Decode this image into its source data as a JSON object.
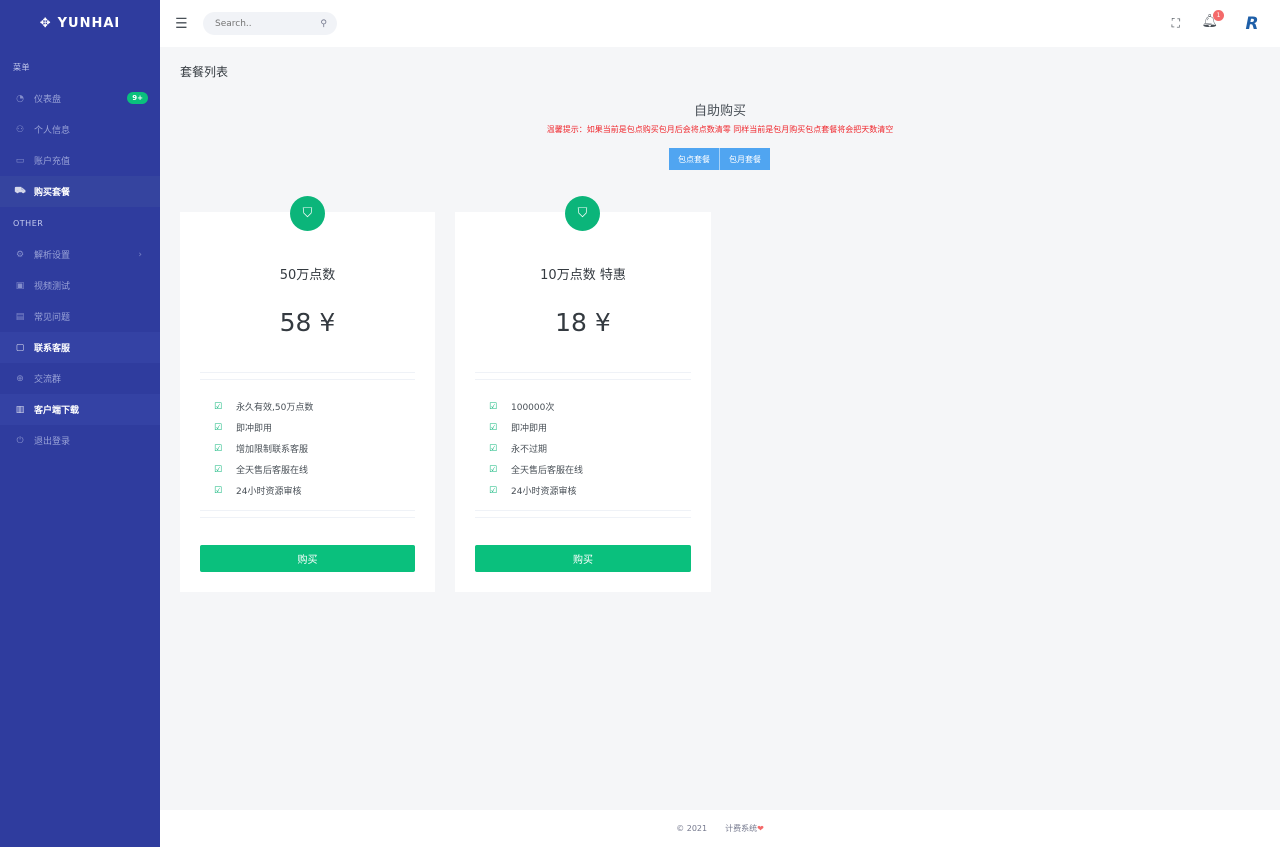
{
  "brand": {
    "name": "YUNHAI",
    "icon": "move-icon"
  },
  "sidebar": {
    "section_menu": "菜单",
    "section_other": "OTHER",
    "items": [
      {
        "label": "仪表盘",
        "icon": "dashboard-icon",
        "badge": "9+"
      },
      {
        "label": "个人信息",
        "icon": "user-icon"
      },
      {
        "label": "账户充值",
        "icon": "card-icon"
      },
      {
        "label": "购买套餐",
        "icon": "cart-icon"
      },
      {
        "label": "解析设置",
        "icon": "settings-icon"
      },
      {
        "label": "视频测试",
        "icon": "video-icon"
      },
      {
        "label": "常见问题",
        "icon": "book-icon"
      },
      {
        "label": "联系客服",
        "icon": "chat-icon"
      },
      {
        "label": "交流群",
        "icon": "group-icon"
      },
      {
        "label": "客户端下载",
        "icon": "file-icon"
      },
      {
        "label": "退出登录",
        "icon": "power-icon"
      }
    ]
  },
  "topbar": {
    "search_placeholder": "Search..",
    "notification_count": "1",
    "avatar_letter": "R"
  },
  "page": {
    "title": "套餐列表",
    "self_title": "自助购买",
    "notice": "温馨提示：如果当前是包点购买包月后会将点数清零 同样当前是包月购买包点套餐将会把天数清空",
    "tabs": [
      "包点套餐",
      "包月套餐"
    ]
  },
  "plans": [
    {
      "name": "50万点数",
      "price": "58 ¥",
      "features": [
        "永久有效,50万点数",
        "即冲即用",
        "增加限制联系客服",
        "全天售后客服在线",
        "24小时资源审核"
      ],
      "button": "购买"
    },
    {
      "name": "10万点数 特惠",
      "price": "18 ¥",
      "features": [
        "100000次",
        "即冲即用",
        "永不过期",
        "全天售后客服在线",
        "24小时资源审核"
      ],
      "button": "购买"
    }
  ],
  "footer": {
    "copyright": "© 2021",
    "system": "计费系统",
    "heart": "❤"
  },
  "colors": {
    "sidebar": "#2f3c9e",
    "accent_green": "#0ac07d",
    "tab_blue": "#50a5f1",
    "notice_red": "#f0282e"
  }
}
